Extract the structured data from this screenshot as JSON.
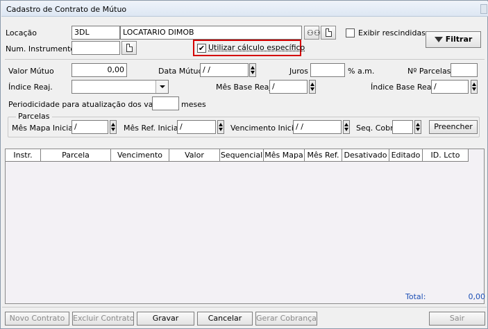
{
  "window": {
    "title": "Cadastro de Contrato de Mútuo"
  },
  "header": {
    "locacao_label": "Locação",
    "locacao_code": "3DL",
    "locacao_name": "LOCATARIO DIMOB",
    "num_instrumento_label": "Num. Instrumento",
    "num_instrumento_value": "",
    "exibir_rescindidas_label": "Exibir rescindidas",
    "exibir_rescindidas_checked": false,
    "utilizar_calculo_label": "Utilizar cálculo específico",
    "utilizar_calculo_checked": true,
    "filtrar_label": "Filtrar"
  },
  "form": {
    "valor_mutuo_label": "Valor Mútuo",
    "valor_mutuo_value": "0,00",
    "data_mutuo_label": "Data Mútuo",
    "data_mutuo_value": " / /",
    "juros_label": "Juros",
    "juros_value": "",
    "juros_unit": "% a.m.",
    "n_parcelas_label": "Nº Parcelas",
    "n_parcelas_value": "",
    "indice_reaj_label": "Índice Reaj.",
    "indice_reaj_value": "",
    "mes_base_reaj_label": "Mês Base Reaj.",
    "mes_base_reaj_value": " /",
    "indice_base_reaj_label": "Índice Base Reaj.",
    "indice_base_reaj_value": " /",
    "periodicidade_label": "Periodicidade para atualização dos valores",
    "periodicidade_value": "",
    "periodicidade_unit": "meses"
  },
  "parcelas": {
    "group_label": "Parcelas",
    "mes_mapa_inicial_label": "Mês Mapa Inicial",
    "mes_mapa_inicial_value": " /",
    "mes_ref_inicial_label": "Mês Ref. Inicial",
    "mes_ref_inicial_value": " /",
    "vencimento_inicial_label": "Vencimento Inicial",
    "vencimento_inicial_value": " / /",
    "seq_cobr_label": "Seq. Cobr.",
    "seq_cobr_value": "",
    "preencher_label": "Preencher"
  },
  "table": {
    "columns": [
      "Instr.",
      "Parcela",
      "Vencimento",
      "Valor",
      "Sequencial",
      "Mês Mapa",
      "Mês Ref.",
      "Desativado",
      "Editado",
      "ID. Lcto"
    ],
    "rows": []
  },
  "totals": {
    "total_label": "Total:",
    "total_value": "0,00"
  },
  "footer": {
    "novo_contrato": "Novo Contrato",
    "excluir_contrato": "Excluir Contrato",
    "gravar": "Gravar",
    "cancelar": "Cancelar",
    "gerar_cobranca": "Gerar Cobrança",
    "sair": "Sair"
  },
  "colors": {
    "highlight_border": "#d40000",
    "total_text": "#1c4fb5"
  }
}
